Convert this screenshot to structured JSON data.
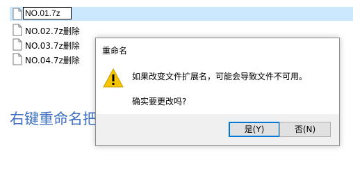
{
  "files": [
    {
      "name": "NO.01.7z",
      "editing": true
    },
    {
      "name": "NO.02.7z删除"
    },
    {
      "name": "NO.03.7z删除"
    },
    {
      "name": "NO.04.7z删除"
    }
  ],
  "caption": "右键重命名把“删除”两个字去掉",
  "dialog": {
    "title": "重命名",
    "icon": "warning-icon",
    "message": "如果改变文件扩展名，可能会导致文件不可用。",
    "question": "确实要更改吗?",
    "yes_label": "是(Y)",
    "no_label": "否(N)"
  },
  "colors": {
    "selection": "#cce8ff",
    "caption": "#3f6fbf",
    "button_focus_border": "#0078d7",
    "warning": "#f5c400"
  }
}
